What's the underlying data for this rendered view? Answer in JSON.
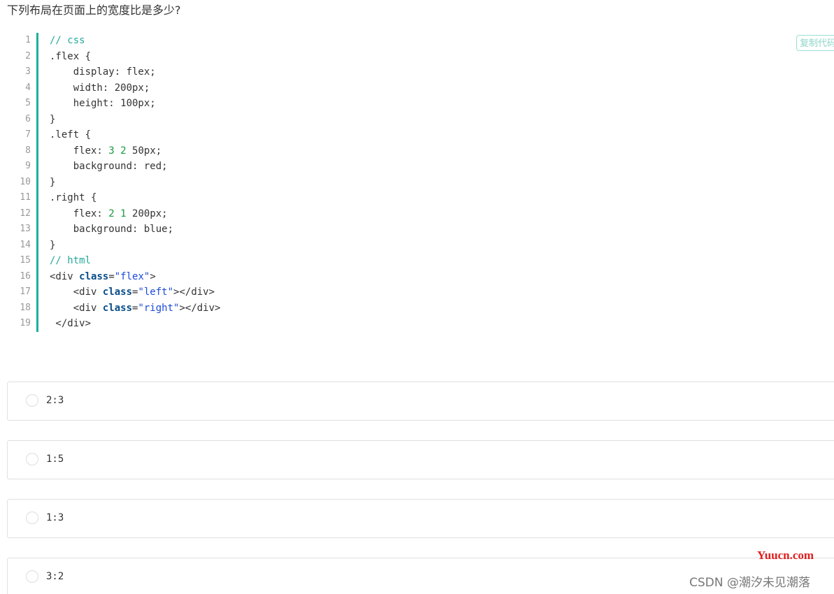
{
  "question": {
    "title": "下列布局在页面上的宽度比是多少?"
  },
  "code": {
    "copy_label": "复制代码",
    "lines": [
      {
        "n": "1",
        "tokens": [
          {
            "t": "// css",
            "c": "comment"
          }
        ]
      },
      {
        "n": "2",
        "tokens": [
          {
            "t": ".flex {",
            "c": ""
          }
        ]
      },
      {
        "n": "3",
        "tokens": [
          {
            "t": "    display: flex;",
            "c": ""
          }
        ]
      },
      {
        "n": "4",
        "tokens": [
          {
            "t": "    width: 200px;",
            "c": ""
          }
        ]
      },
      {
        "n": "5",
        "tokens": [
          {
            "t": "    height: 100px;",
            "c": ""
          }
        ]
      },
      {
        "n": "6",
        "tokens": [
          {
            "t": "}",
            "c": ""
          }
        ]
      },
      {
        "n": "7",
        "tokens": [
          {
            "t": ".left {",
            "c": ""
          }
        ]
      },
      {
        "n": "8",
        "tokens": [
          {
            "t": "    flex: ",
            "c": ""
          },
          {
            "t": "3",
            "c": "number"
          },
          {
            "t": " ",
            "c": ""
          },
          {
            "t": "2",
            "c": "number"
          },
          {
            "t": " 50px;",
            "c": ""
          }
        ]
      },
      {
        "n": "9",
        "tokens": [
          {
            "t": "    background: red;",
            "c": ""
          }
        ]
      },
      {
        "n": "10",
        "tokens": [
          {
            "t": "}",
            "c": ""
          }
        ]
      },
      {
        "n": "11",
        "tokens": [
          {
            "t": ".right {",
            "c": ""
          }
        ]
      },
      {
        "n": "12",
        "tokens": [
          {
            "t": "    flex: ",
            "c": ""
          },
          {
            "t": "2",
            "c": "number"
          },
          {
            "t": " ",
            "c": ""
          },
          {
            "t": "1",
            "c": "number"
          },
          {
            "t": " 200px;",
            "c": ""
          }
        ]
      },
      {
        "n": "13",
        "tokens": [
          {
            "t": "    background: blue;",
            "c": ""
          }
        ]
      },
      {
        "n": "14",
        "tokens": [
          {
            "t": "}",
            "c": ""
          }
        ]
      },
      {
        "n": "15",
        "tokens": [
          {
            "t": "// html",
            "c": "comment"
          }
        ]
      },
      {
        "n": "16",
        "tokens": [
          {
            "t": "<div ",
            "c": ""
          },
          {
            "t": "class",
            "c": "keyword"
          },
          {
            "t": "=",
            "c": ""
          },
          {
            "t": "\"flex\"",
            "c": "string"
          },
          {
            "t": ">",
            "c": ""
          }
        ]
      },
      {
        "n": "17",
        "tokens": [
          {
            "t": "    <div ",
            "c": ""
          },
          {
            "t": "class",
            "c": "keyword"
          },
          {
            "t": "=",
            "c": ""
          },
          {
            "t": "\"left\"",
            "c": "string"
          },
          {
            "t": "></div>",
            "c": ""
          }
        ]
      },
      {
        "n": "18",
        "tokens": [
          {
            "t": "    <div ",
            "c": ""
          },
          {
            "t": "class",
            "c": "keyword"
          },
          {
            "t": "=",
            "c": ""
          },
          {
            "t": "\"right\"",
            "c": "string"
          },
          {
            "t": "></div>",
            "c": ""
          }
        ]
      },
      {
        "n": "19",
        "tokens": [
          {
            "t": " </div>",
            "c": ""
          }
        ]
      }
    ]
  },
  "options": [
    {
      "label": "2:3"
    },
    {
      "label": "1:5"
    },
    {
      "label": "1:3"
    },
    {
      "label": "3:2"
    }
  ],
  "watermark": {
    "site": "Yuucn.com",
    "author": "CSDN @潮汐未见潮落"
  },
  "colors": {
    "accent": "#1eae9b",
    "comment": "#25a99a",
    "keyword": "#0a4e8a",
    "string": "#1c4ad8",
    "number": "#1a9a3f",
    "watermark_site": "#e0201e"
  }
}
